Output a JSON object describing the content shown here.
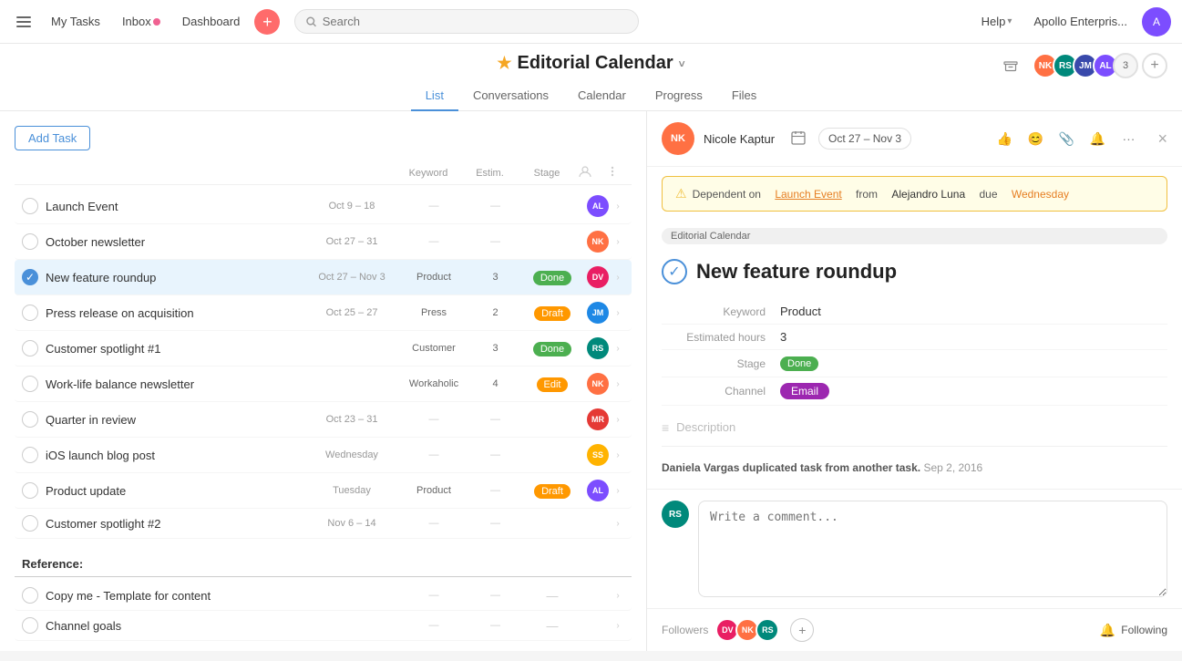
{
  "nav": {
    "menu_label": "☰",
    "my_tasks": "My Tasks",
    "inbox": "Inbox",
    "dashboard": "Dashboard",
    "add_btn": "+",
    "search_placeholder": "Search",
    "help": "Help",
    "enterprise": "Apollo Enterpris...",
    "chevron": "▾"
  },
  "project": {
    "star": "★",
    "title": "Editorial Calendar",
    "dropdown": "˅",
    "tabs": [
      "List",
      "Conversations",
      "Calendar",
      "Progress",
      "Files"
    ],
    "active_tab": "List",
    "member_count": "3"
  },
  "task_list": {
    "add_task": "Add Task",
    "columns": {
      "keyword": "Keyword",
      "estim": "Estim.",
      "stage": "Stage"
    },
    "tasks": [
      {
        "name": "Launch Event",
        "date": "Oct 9 – 18",
        "keyword": "",
        "estim": "—",
        "stage": "",
        "av_color": "av-purple",
        "av_initials": "AL"
      },
      {
        "name": "October newsletter",
        "date": "Oct 27 – 31",
        "keyword": "",
        "estim": "—",
        "stage": "",
        "av_color": "av-orange",
        "av_initials": "NK"
      },
      {
        "name": "New feature roundup",
        "date": "Oct 27 – Nov 3",
        "keyword": "Product",
        "estim": "3",
        "stage": "Done",
        "stage_class": "stage-done",
        "av_color": "av-pink",
        "av_initials": "DV",
        "selected": true
      },
      {
        "name": "Press release on acquisition",
        "date": "Oct 25 – 27",
        "keyword": "Press",
        "estim": "2",
        "stage": "Draft",
        "stage_class": "stage-draft",
        "av_color": "av-blue",
        "av_initials": "JM"
      },
      {
        "name": "Customer spotlight #1",
        "date": "",
        "keyword": "Customer",
        "estim": "3",
        "stage": "Done",
        "stage_class": "stage-done",
        "av_color": "av-teal",
        "av_initials": "RS"
      },
      {
        "name": "Work-life balance newsletter",
        "date": "",
        "keyword": "Workaholic",
        "estim": "4",
        "stage": "Edit",
        "stage_class": "stage-edit",
        "av_color": "av-orange",
        "av_initials": "NK"
      },
      {
        "name": "Quarter in review",
        "date": "Oct 23 – 31",
        "keyword": "",
        "estim": "—",
        "stage": "",
        "av_color": "av-red",
        "av_initials": "MR"
      },
      {
        "name": "iOS launch blog post",
        "date": "Wednesday",
        "keyword": "",
        "estim": "—",
        "stage": "",
        "av_color": "av-amber",
        "av_initials": "SS"
      },
      {
        "name": "Product update",
        "date": "Tuesday",
        "keyword": "Product",
        "estim": "—",
        "stage": "Draft",
        "stage_class": "stage-draft",
        "av_color": "av-purple",
        "av_initials": "AL"
      },
      {
        "name": "Customer spotlight #2",
        "date": "Nov 6 – 14",
        "keyword": "",
        "estim": "—",
        "stage": "",
        "av_color": "",
        "av_initials": ""
      }
    ],
    "section_header": "Reference:",
    "reference_tasks": [
      {
        "name": "Copy me - Template for content"
      },
      {
        "name": "Channel goals"
      }
    ]
  },
  "task_detail": {
    "assignee": "Nicole Kaptur",
    "date_range": "Oct 27 – Nov 3",
    "close": "×",
    "dependency": {
      "text_before": "Dependent on",
      "link": "Launch Event",
      "text_middle": "from",
      "person": "Alejandro Luna",
      "text_after": "due",
      "due": "Wednesday"
    },
    "tag": "Editorial Calendar",
    "title": "New feature roundup",
    "fields": [
      {
        "label": "Keyword",
        "value": "Product",
        "type": "text"
      },
      {
        "label": "Estimated hours",
        "value": "3",
        "type": "text"
      },
      {
        "label": "Stage",
        "value": "Done",
        "type": "badge-done"
      },
      {
        "label": "Channel",
        "value": "Email",
        "type": "badge-email"
      }
    ],
    "description_placeholder": "Description",
    "activity": {
      "text": "Daniela Vargas duplicated task from another task.",
      "date": "Sep 2, 2016"
    },
    "comment_placeholder": "Write a comment...",
    "followers_label": "Followers",
    "following": "Following",
    "followers": [
      {
        "color": "av-pink",
        "initials": "DV"
      },
      {
        "color": "av-orange",
        "initials": "NK"
      },
      {
        "color": "av-teal",
        "initials": "RS"
      }
    ]
  }
}
